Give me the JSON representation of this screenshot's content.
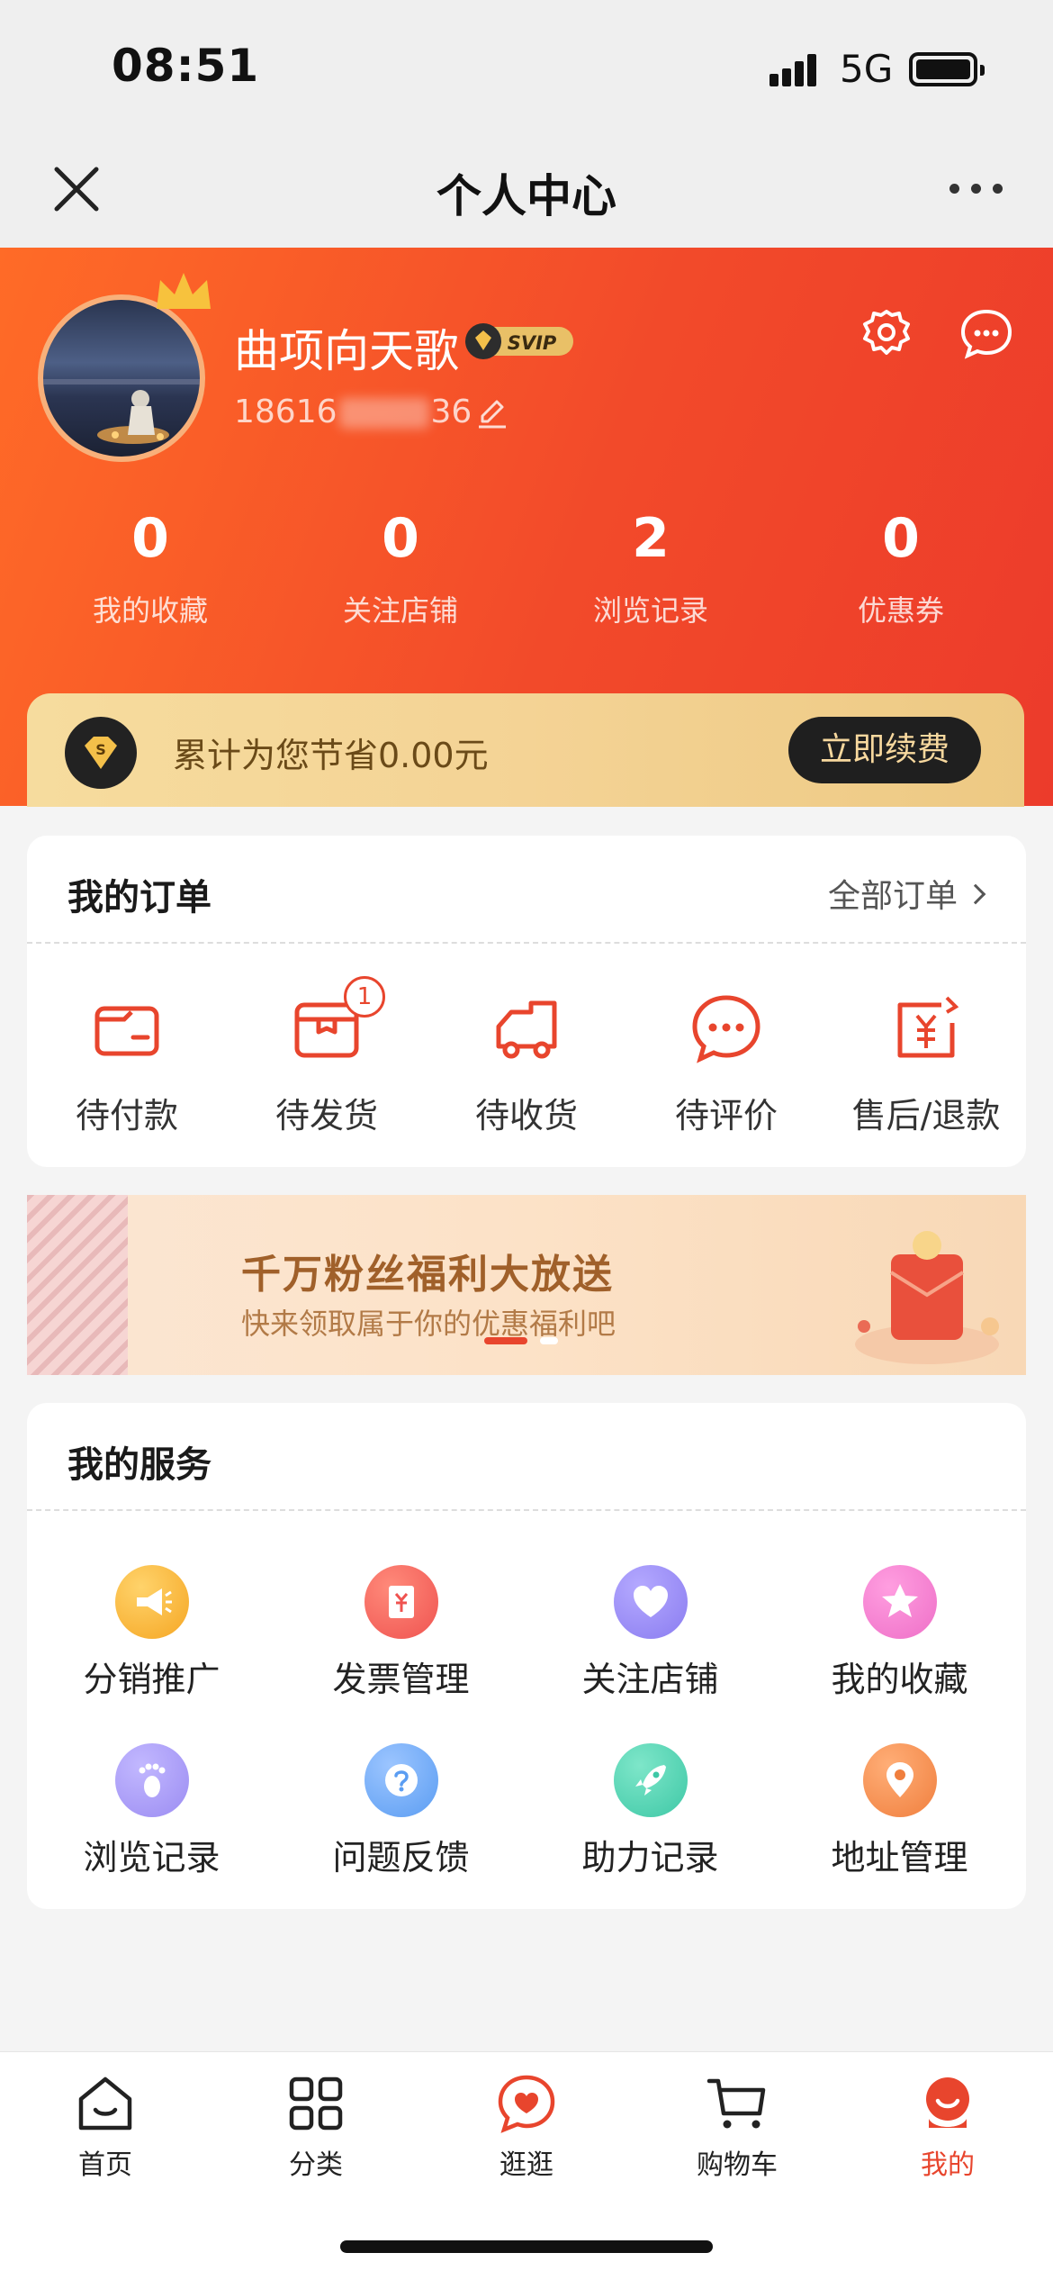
{
  "status": {
    "time": "08:51",
    "network": "5G"
  },
  "nav": {
    "title": "个人中心"
  },
  "profile": {
    "username": "曲项向天歌",
    "badge": "SVIP",
    "phone_prefix": "18616",
    "phone_suffix": "36"
  },
  "stats": [
    {
      "value": "0",
      "label": "我的收藏"
    },
    {
      "value": "0",
      "label": "关注店铺"
    },
    {
      "value": "2",
      "label": "浏览记录"
    },
    {
      "value": "0",
      "label": "优惠券"
    }
  ],
  "vip": {
    "saved_text": "累计为您节省0.00元",
    "renew_label": "立即续费"
  },
  "orders": {
    "title": "我的订单",
    "all_label": "全部订单",
    "items": [
      {
        "label": "待付款",
        "icon": "wallet-icon"
      },
      {
        "label": "待发货",
        "icon": "box-icon",
        "badge": "1"
      },
      {
        "label": "待收货",
        "icon": "truck-icon"
      },
      {
        "label": "待评价",
        "icon": "comment-icon"
      },
      {
        "label": "售后/退款",
        "icon": "refund-icon"
      }
    ]
  },
  "banner": {
    "title": "千万粉丝福利大放送",
    "subtitle": "快来领取属于你的优惠福利吧"
  },
  "services": {
    "title": "我的服务",
    "items": [
      {
        "label": "分销推广",
        "icon": "megaphone-icon",
        "color": "#f5a623"
      },
      {
        "label": "发票管理",
        "icon": "invoice-icon",
        "color": "#ef5350"
      },
      {
        "label": "关注店铺",
        "icon": "heart-icon",
        "color": "#8a7cf0"
      },
      {
        "label": "我的收藏",
        "icon": "star-icon",
        "color": "#ee6fc7"
      },
      {
        "label": "浏览记录",
        "icon": "footprint-icon",
        "color": "#9b8cf2"
      },
      {
        "label": "问题反馈",
        "icon": "question-icon",
        "color": "#5b9df2"
      },
      {
        "label": "助力记录",
        "icon": "rocket-icon",
        "color": "#3ec8a6"
      },
      {
        "label": "地址管理",
        "icon": "location-icon",
        "color": "#f07f3e"
      }
    ]
  },
  "tabs": [
    {
      "label": "首页",
      "icon": "home-icon"
    },
    {
      "label": "分类",
      "icon": "grid-icon"
    },
    {
      "label": "逛逛",
      "icon": "heart-chat-icon"
    },
    {
      "label": "购物车",
      "icon": "cart-icon"
    },
    {
      "label": "我的",
      "icon": "profile-icon",
      "active": true
    }
  ],
  "colors": {
    "brand": "#e8452d",
    "vip_gold": "#f4d395",
    "active_tab": "#e8452d"
  }
}
